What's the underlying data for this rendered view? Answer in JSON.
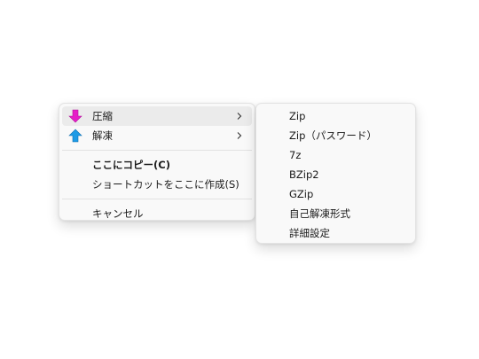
{
  "main_menu": {
    "items": [
      {
        "label": "圧縮",
        "icon": "pink-down-arrow-icon",
        "has_submenu": true,
        "hovered": true
      },
      {
        "label": "解凍",
        "icon": "blue-up-arrow-icon",
        "has_submenu": true
      },
      {
        "label": "ここにコピー(C)",
        "bold": true
      },
      {
        "label": "ショートカットをここに作成(S)"
      },
      {
        "label": "キャンセル"
      }
    ]
  },
  "sub_menu": {
    "items": [
      {
        "label": "Zip"
      },
      {
        "label": "Zip（パスワード）"
      },
      {
        "label": "7z"
      },
      {
        "label": "BZip2"
      },
      {
        "label": "GZip"
      },
      {
        "label": "自己解凍形式"
      },
      {
        "label": "詳細設定"
      }
    ]
  },
  "colors": {
    "compress_arrow": "#e61ec8",
    "extract_arrow": "#1e9be6",
    "menu_background": "#f9f9f9",
    "hover_background": "#ebebeb"
  }
}
